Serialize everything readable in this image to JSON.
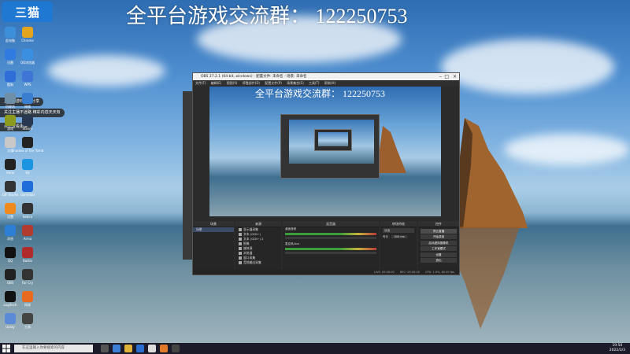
{
  "overlay": {
    "banner": "全平台游戏交流群：  122250753"
  },
  "desktop": {
    "logo_text": "三猫",
    "toasts": [
      "主播的游戏技巧分享",
      "关注主播不迷路 精彩内容天天有",
      "点击查看更多"
    ],
    "icons": [
      {
        "label": "此电脑",
        "color": "#3c8fd8"
      },
      {
        "label": "Chrome",
        "color": "#e3a51e"
      },
      {
        "label": "迅雷",
        "color": "#2f7be0"
      },
      {
        "label": "QQ浏览器",
        "color": "#3a8fe0"
      },
      {
        "label": "酷狗",
        "color": "#2f6ed8"
      },
      {
        "label": "WPS",
        "color": "#3f76d6"
      },
      {
        "label": "回收站",
        "color": "#6f8ea8"
      },
      {
        "label": "网络",
        "color": "#3a7fcf"
      },
      {
        "label": "游戏",
        "color": "#8c9a1e"
      },
      {
        "label": "Steam",
        "color": "#283850"
      },
      {
        "label": "文档",
        "color": "#c8c8c8"
      },
      {
        "label": "Shadow of the Tomb",
        "color": "#222"
      },
      {
        "label": "Vmix",
        "color": "#222"
      },
      {
        "label": "Hz",
        "color": "#1b95e0"
      },
      {
        "label": "GIF Studio",
        "color": "#333"
      },
      {
        "label": "Gamebar",
        "color": "#1f6dd8"
      },
      {
        "label": "设置",
        "color": "#f08a1e"
      },
      {
        "label": "Sekiro",
        "color": "#333"
      },
      {
        "label": "消息",
        "color": "#2d7fd6"
      },
      {
        "label": "Arma",
        "color": "#b13b2e"
      },
      {
        "label": "QQ",
        "color": "#111"
      },
      {
        "label": "Battle",
        "color": "#b02a2a"
      },
      {
        "label": "OBS",
        "color": "#222"
      },
      {
        "label": "Far Cry",
        "color": "#333"
      },
      {
        "label": "Logitech",
        "color": "#111"
      },
      {
        "label": "网易",
        "color": "#e86a1e"
      },
      {
        "label": "Uplay",
        "color": "#5a8ad8"
      },
      {
        "label": "工具",
        "color": "#444"
      }
    ]
  },
  "obs": {
    "title": "OBS 27.2.1 (64-bit, windows) - 配置文件: 未命名 - 场景: 未命名",
    "menu": [
      "文件(F)",
      "编辑(E)",
      "视图(V)",
      "停靠部件(D)",
      "配置文件(P)",
      "场景集合(S)",
      "工具(T)",
      "帮助(H)"
    ],
    "preview_banner": "全平台游戏交流群：  122250753",
    "docks": {
      "scenes": {
        "header": "场景",
        "items": [
          "场景"
        ]
      },
      "sources": {
        "header": "来源",
        "items": [
          "显示器采集",
          "文本 (GDI+)",
          "文本 (GDI+) 2",
          "图像",
          "媒体源",
          "浏览器",
          "窗口采集",
          "音频输出采集"
        ]
      },
      "mixer": {
        "header": "混音器",
        "channels": [
          {
            "name": "桌面音频"
          },
          {
            "name": "麦克风/Aux"
          }
        ]
      },
      "transitions": {
        "header": "转场特效",
        "type_label": "淡出",
        "duration_label": "时长",
        "duration_value": "300 ms"
      },
      "controls": {
        "header": "控件",
        "buttons": [
          "停止直播",
          "开始录制",
          "启动虚拟摄像机",
          "工作室模式",
          "设置",
          "退出"
        ]
      }
    },
    "statusbar": {
      "live": "LIVE: 00:00:00",
      "rec": "REC: 00:00:00",
      "cpu": "CPU: 1.9%, 60.00 fps"
    }
  },
  "taskbar": {
    "search_placeholder": "在这里输入你要搜索的内容",
    "time": "19:50",
    "date": "2022/3/3"
  }
}
